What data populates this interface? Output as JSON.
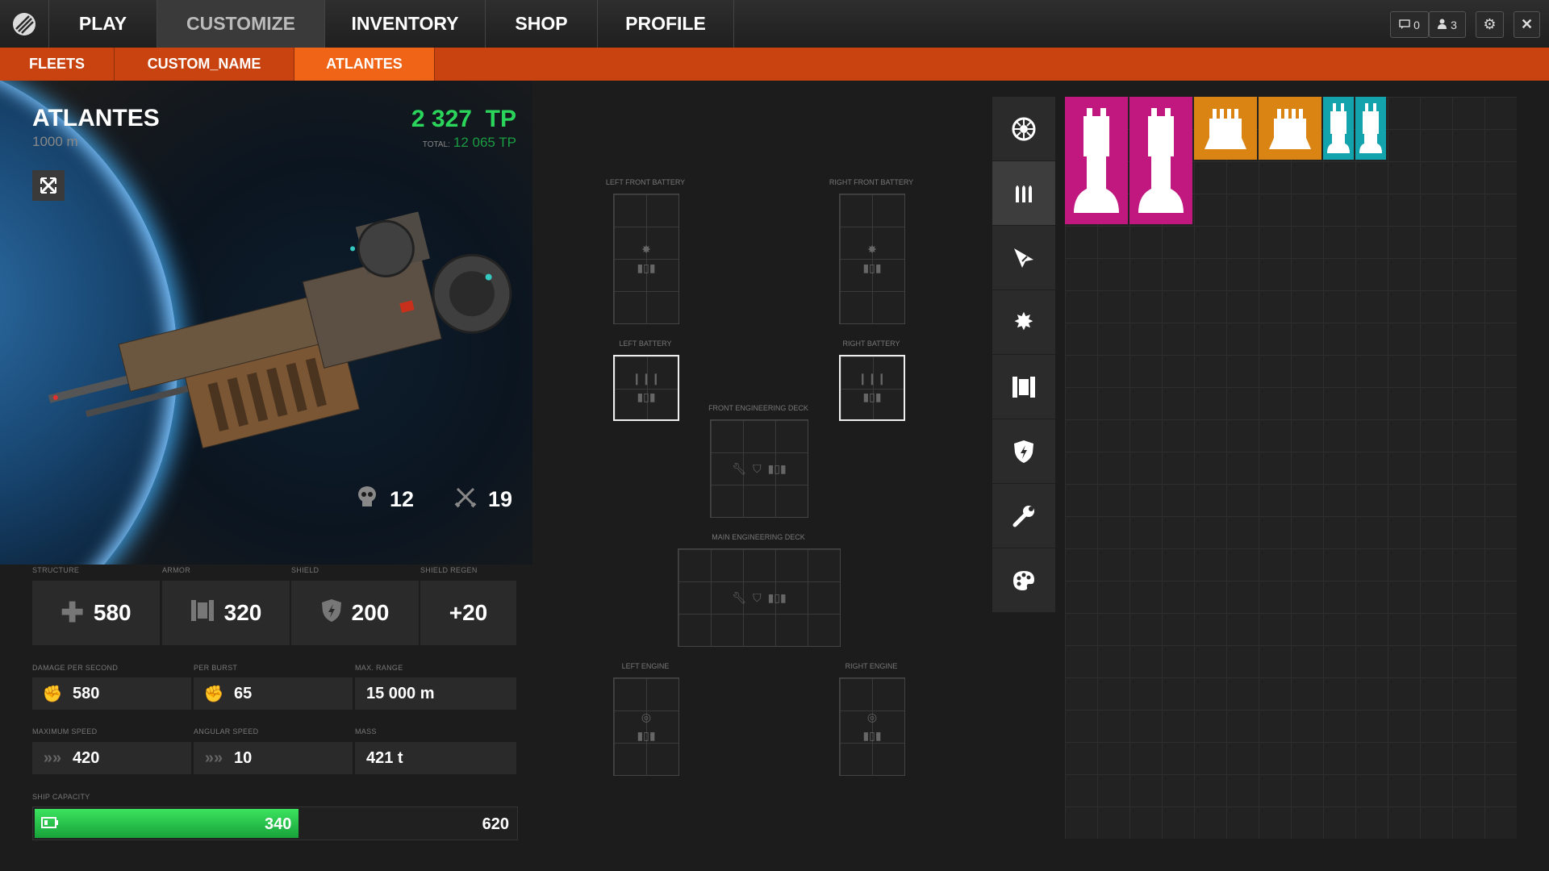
{
  "nav": {
    "tabs": [
      {
        "label": "PLAY"
      },
      {
        "label": "CUSTOMIZE"
      },
      {
        "label": "INVENTORY"
      },
      {
        "label": "SHOP"
      },
      {
        "label": "PROFILE"
      }
    ],
    "messages_count": "0",
    "friends_count": "3"
  },
  "subnav": {
    "items": [
      {
        "label": "FLEETS"
      },
      {
        "label": "CUSTOM_NAME"
      },
      {
        "label": "ATLANTES"
      }
    ]
  },
  "ship": {
    "name": "ATLANTES",
    "length": "1000 m",
    "tp": "2 327",
    "tp_unit": "TP",
    "total_label": "TOTAL:",
    "total_tp": "12 065 TP",
    "kills": "12",
    "battles": "19"
  },
  "stats": {
    "structure": {
      "label": "STRUCTURE",
      "value": "580"
    },
    "armor": {
      "label": "ARMOR",
      "value": "320"
    },
    "shield": {
      "label": "SHIELD",
      "value": "200"
    },
    "shield_regen": {
      "label": "SHIELD REGEN",
      "value": "+20"
    },
    "dps": {
      "label": "DAMAGE PER SECOND",
      "value": "580"
    },
    "per_burst": {
      "label": "PER BURST",
      "value": "65"
    },
    "max_range": {
      "label": "MAX. RANGE",
      "value": "15 000 m"
    },
    "max_speed": {
      "label": "MAXIMUM SPEED",
      "value": "420"
    },
    "angular_speed": {
      "label": "ANGULAR SPEED",
      "value": "10"
    },
    "mass": {
      "label": "MASS",
      "value": "421 t"
    }
  },
  "capacity": {
    "label": "SHIP CAPACITY",
    "used": "340",
    "max": "620",
    "fill_fraction": 0.548
  },
  "slots": {
    "left_front_battery": "LEFT FRONT BATTERY",
    "right_front_battery": "RIGHT FRONT BATTERY",
    "left_battery": "LEFT BATTERY",
    "right_battery": "RIGHT BATTERY",
    "front_engineering_deck": "FRONT ENGINEERING DECK",
    "main_engineering_deck": "MAIN ENGINEERING DECK",
    "left_engine": "LEFT ENGINE",
    "right_engine": "RIGHT ENGINE"
  },
  "categories": [
    "engine-icon",
    "ammo-icon",
    "missile-icon",
    "burst-icon",
    "armor-icon",
    "shield-icon",
    "wrench-icon",
    "palette-icon"
  ],
  "inventory_items": [
    {
      "type": "twin-tall-turret",
      "color": "#c0187e"
    },
    {
      "type": "twin-tall-turret",
      "color": "#c0187e"
    },
    {
      "type": "quad-turret",
      "color": "#d98413"
    },
    {
      "type": "quad-turret",
      "color": "#d98413"
    },
    {
      "type": "small-twin-turret",
      "color": "#13a3ad"
    },
    {
      "type": "small-twin-turret",
      "color": "#13a3ad"
    }
  ],
  "colors": {
    "accent": "#f06418",
    "tp_green": "#2bd45a",
    "capacity_green": "#2bd45a"
  }
}
